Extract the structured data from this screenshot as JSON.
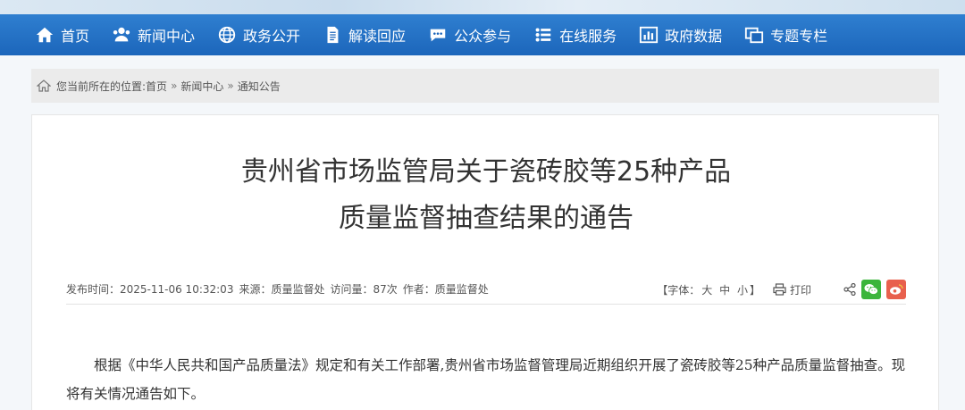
{
  "nav": {
    "items": [
      {
        "label": "首页",
        "icon": "home-icon"
      },
      {
        "label": "新闻中心",
        "icon": "people-icon"
      },
      {
        "label": "政务公开",
        "icon": "globe-icon"
      },
      {
        "label": "解读回应",
        "icon": "document-icon"
      },
      {
        "label": "公众参与",
        "icon": "chat-icon"
      },
      {
        "label": "在线服务",
        "icon": "list-icon"
      },
      {
        "label": "政府数据",
        "icon": "bar-chart-icon"
      },
      {
        "label": "专题专栏",
        "icon": "window-icon"
      }
    ]
  },
  "breadcrumb": {
    "prefix": "您当前所在的位置:",
    "items": [
      "首页",
      "新闻中心",
      "通知公告"
    ],
    "separator": "»"
  },
  "article": {
    "title_line1": "贵州省市场监管局关于瓷砖胶等25种产品",
    "title_line2": "质量监督抽查结果的通告",
    "meta": {
      "publish_time": "发布时间：2025-11-06 10:32:03",
      "source": "来源：质量监督处",
      "views": "访问量：87次",
      "author": "作者：质量监督处"
    },
    "font_size": {
      "open": "【字体：",
      "large": "大",
      "medium": "中",
      "small": "小",
      "close": "】"
    },
    "print_label": "打印",
    "body": "根据《中华人民共和国产品质量法》规定和有关工作部署,贵州省市场监督管理局近期组织开展了瓷砖胶等25种产品质量监督抽查。现将有关情况通告如下。"
  },
  "colors": {
    "nav_bg": "#1c66bb",
    "wechat": "#3bb53b",
    "weibo": "#e8604d"
  }
}
